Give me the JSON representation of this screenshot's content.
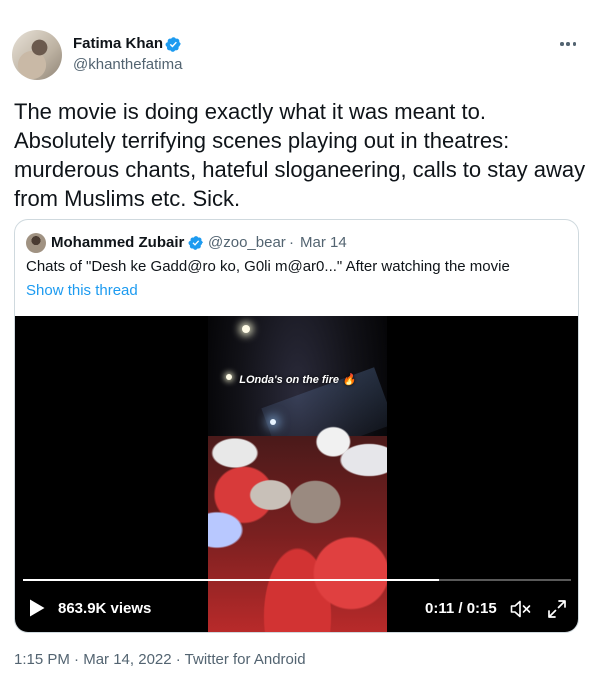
{
  "author": {
    "name": "Fatima Khan",
    "handle": "@khanthefatima",
    "verified": true
  },
  "tweet": {
    "text": "The movie is doing exactly what it was meant to. Absolutely terrifying scenes playing out in theatres: murderous chants, hateful sloganeering, calls to stay away from Muslims etc. Sick."
  },
  "quote": {
    "author_name": "Mohammed Zubair",
    "author_handle": "@zoo_bear",
    "separator": "·",
    "date": "Mar 14",
    "verified": true,
    "text": "Chats of \"Desh ke Gadd@ro ko, G0li m@ar0...\" After watching the movie",
    "show_thread": "Show this thread",
    "video": {
      "caption": "LOnda's on the fire 🔥",
      "views": "863.9K views",
      "time": "0:11 / 0:15",
      "progress": 0.76
    }
  },
  "meta": {
    "time": "1:15 PM",
    "sep1": " · ",
    "date": "Mar 14, 2022",
    "sep2": " · ",
    "source": "Twitter for Android"
  },
  "colors": {
    "verified": "#1d9bf0",
    "link": "#1d9bf0",
    "secondary_text": "#536471",
    "border": "#cfd9de"
  },
  "icons": [
    "more-icon",
    "verified-icon",
    "play-icon",
    "mute-icon",
    "expand-icon"
  ]
}
